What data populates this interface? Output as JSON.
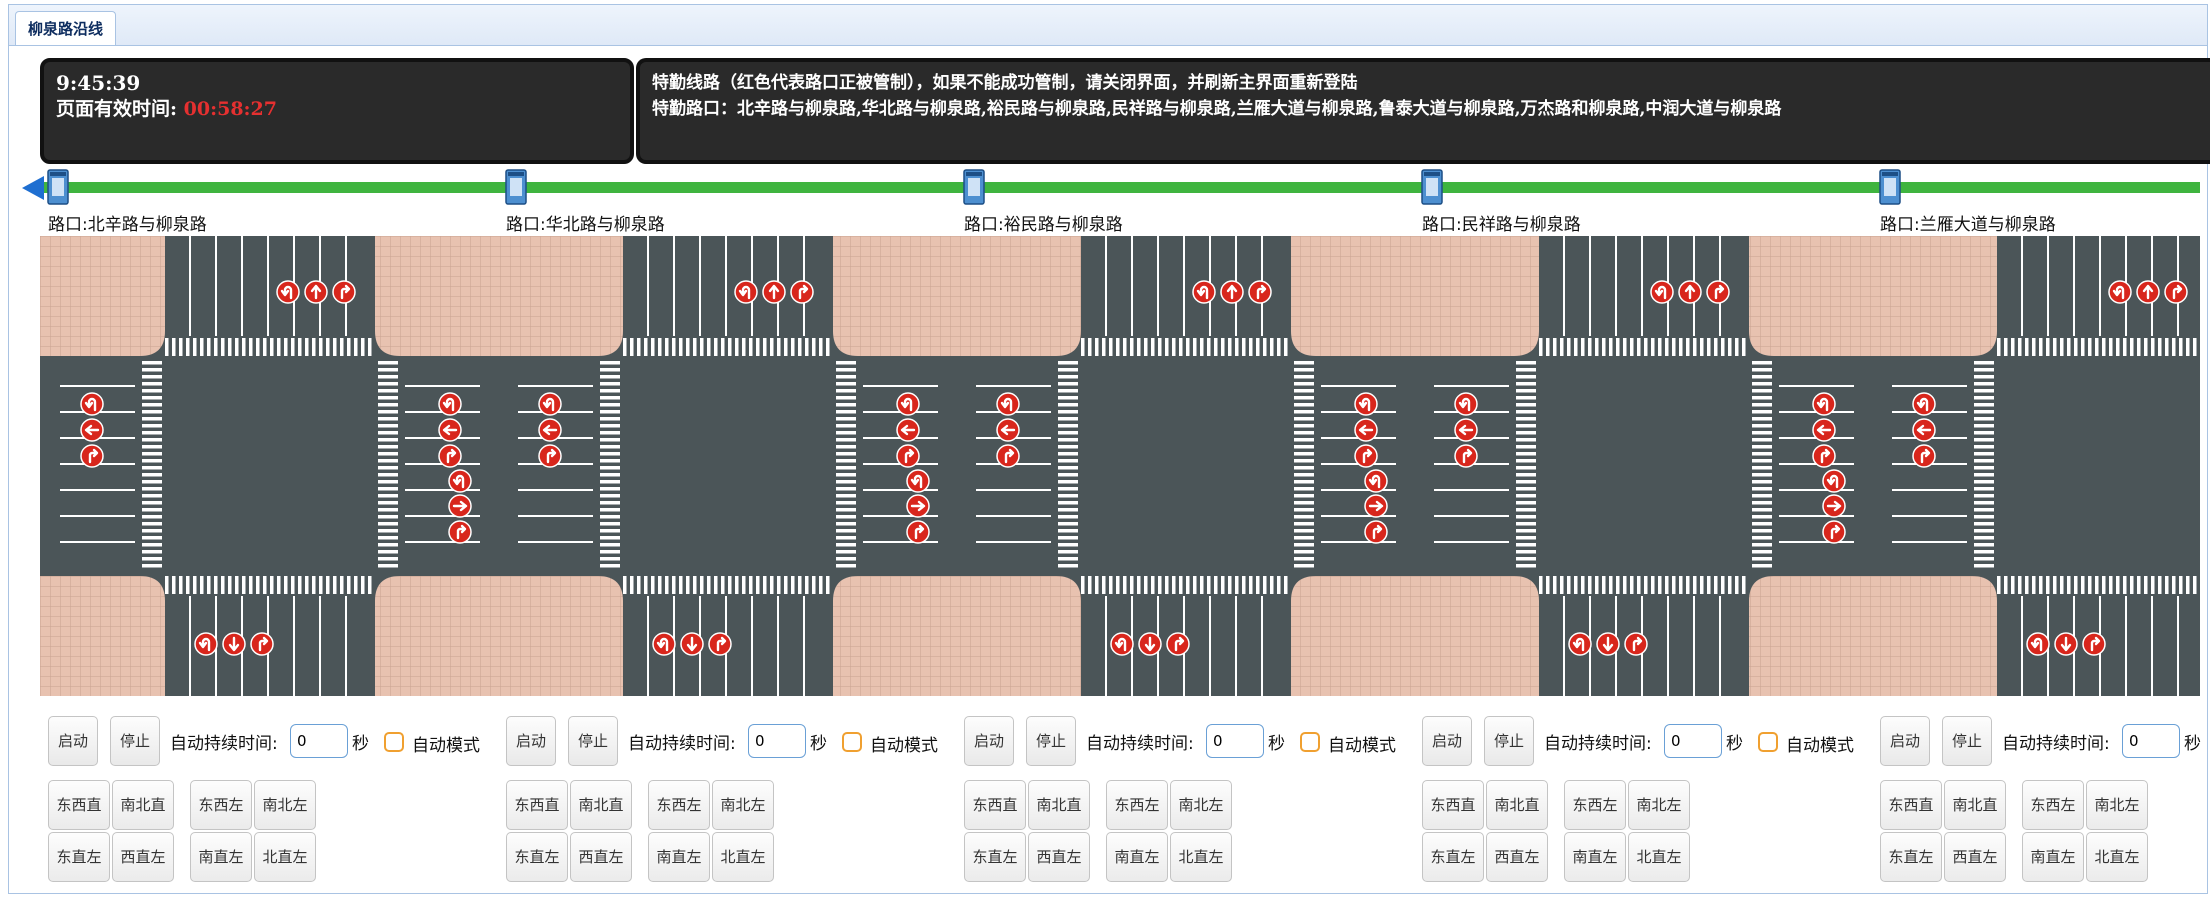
{
  "tab": {
    "label": "柳泉路沿线"
  },
  "status": {
    "clock": "9:45:39",
    "valid_label": "页面有效时间: ",
    "valid_time": "00:58:27"
  },
  "info": {
    "line1": "特勤线路（红色代表路口正被管制），如果不能成功管制，请关闭界面，并刷新主界面重新登陆",
    "line2": "特勤路口：北辛路与柳泉路,华北路与柳泉路,裕民路与柳泉路,民祥路与柳泉路,兰雁大道与柳泉路,鲁泰大道与柳泉路,万杰路和柳泉路,中润大道与柳泉路"
  },
  "colors": {
    "route_green": "#3fb43f",
    "sidewalk": "#e8c2b0",
    "asphalt": "#4b5558",
    "arrow_red": "#d8261c",
    "signal_blue": "#4d8fd0"
  },
  "intersections": [
    {
      "label": "路口:北辛路与柳泉路"
    },
    {
      "label": "路口:华北路与柳泉路"
    },
    {
      "label": "路口:裕民路与柳泉路"
    },
    {
      "label": "路口:民祥路与柳泉路"
    },
    {
      "label": "路口:兰雁大道与柳泉路"
    }
  ],
  "controls": {
    "start": "启动",
    "stop": "停止",
    "duration_label": "自动持续时间:",
    "duration_value": "0",
    "unit": "秒",
    "auto_mode": "自动模式",
    "phases": [
      "东西直",
      "南北直",
      "东西左",
      "南北左",
      "东直左",
      "西直左",
      "南直左",
      "北直左"
    ]
  }
}
